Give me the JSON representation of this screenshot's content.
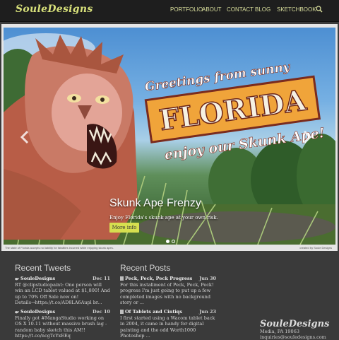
{
  "site": {
    "logo": "SouleDesigns",
    "nav": [
      "PORTFOLIO",
      "ABOUT",
      "CONTACT",
      "BLOG",
      "SKETCHBOOK"
    ],
    "search_icon": "search-icon"
  },
  "hero": {
    "banner_line1": "Greetings from sunny",
    "banner_main": "FLORIDA",
    "banner_line2": "enjoy our Skunk Ape!",
    "title": "Skunk Ape Frenzy",
    "subtitle": "Enjoy Florida's skunk ape at your own risk.",
    "button": "More info",
    "caption_left": "The state of Florida accepts no liability for fatalities incurred while enjoying skunk apes.",
    "caption_right": "created by Soule Designs",
    "active_slide": 1,
    "slide_count": 2
  },
  "tweets": {
    "title": "Recent Tweets",
    "items": [
      {
        "user": "SouleDesigns",
        "date": "Dec 11",
        "text": "RT @clipstudiopaint: One person will win an LCD tablet valued at $1,800! And up to 70% Off Sale now on! Details→https://t.co/AD8LA6Aupl br..."
      },
      {
        "user": "SouleDesigns",
        "date": "Dec 10",
        "text": "Finally got #MangaStudio working on OS X 10.11 without massive brush lag - random baby sketch this AM!! https://t.co/ncgTcYxEEq"
      }
    ]
  },
  "posts": {
    "title": "Recent Posts",
    "items": [
      {
        "title": "Peck, Peck, Peck Progress",
        "date": "Jun 30",
        "text": "For this installment of Peck, Peck, Peck! progress I'm just going to put up a few completed images with no background story or ..."
      },
      {
        "title": "Of Tablets and Cintiqs",
        "date": "Jun 23",
        "text": "I first started using a Wacom tablet back in 2004, it came in handy for digital painting and the odd Worth1000 Photoshop ..."
      }
    ]
  },
  "footer": {
    "logo": "SouleDesigns",
    "location": "Media, PA 19063",
    "email": "inquiries@souledesigns.com"
  },
  "colors": {
    "accent": "#d6df4f",
    "nav_text": "#d9de9c",
    "background": "#3a3a3a",
    "topbar": "#1e1e1e"
  }
}
